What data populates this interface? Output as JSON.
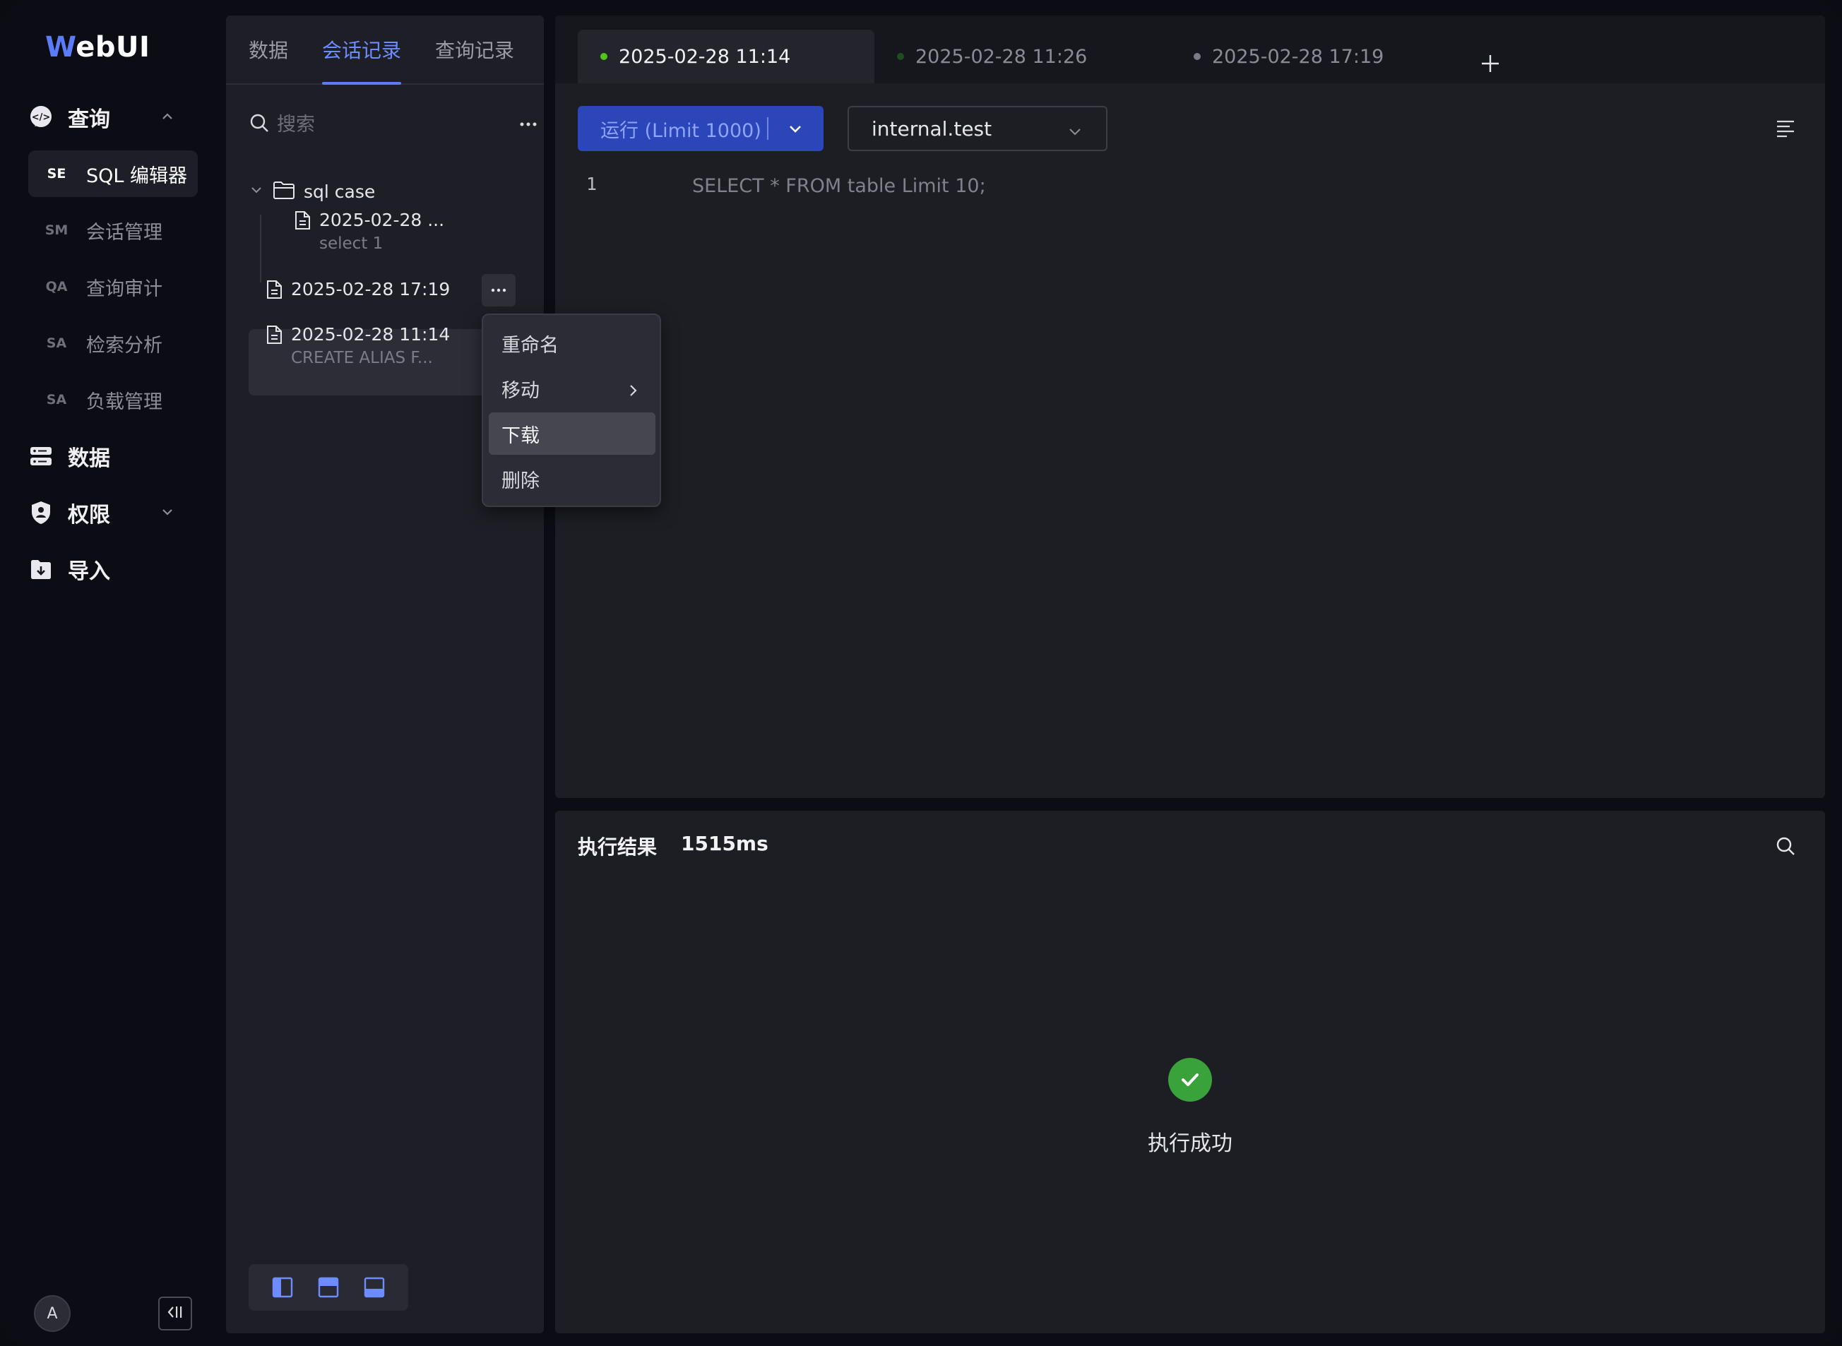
{
  "app": {
    "logo_first": "W",
    "logo_rest": "ebUI"
  },
  "nav": {
    "groups": [
      {
        "label": "查询",
        "icon": "code-chat-icon"
      },
      {
        "label": "数据",
        "icon": "database-icon"
      },
      {
        "label": "权限",
        "icon": "shield-icon"
      },
      {
        "label": "导入",
        "icon": "import-icon"
      }
    ],
    "items": [
      {
        "abbr": "SE",
        "label": "SQL 编辑器"
      },
      {
        "abbr": "SM",
        "label": "会话管理"
      },
      {
        "abbr": "QA",
        "label": "查询审计"
      },
      {
        "abbr": "SA",
        "label": "检索分析"
      },
      {
        "abbr": "SA",
        "label": "负载管理"
      }
    ],
    "avatar": "A"
  },
  "panel": {
    "tabs": [
      "数据",
      "会话记录",
      "查询记录"
    ],
    "search_placeholder": "搜索",
    "folder": "sql case",
    "files": [
      {
        "title": "2025-02-28 ...",
        "subtitle": "select 1"
      },
      {
        "title": "2025-02-28 17:19",
        "subtitle": ""
      },
      {
        "title": "2025-02-28 11:14",
        "subtitle": "CREATE ALIAS F..."
      }
    ]
  },
  "context_menu": {
    "items": [
      "重命名",
      "移动",
      "下载",
      "删除"
    ]
  },
  "editor": {
    "tabs": [
      {
        "label": "2025-02-28 11:14",
        "dot": "#52c41a"
      },
      {
        "label": "2025-02-28 11:26",
        "dot": "#1f4d1f"
      },
      {
        "label": "2025-02-28 17:19",
        "dot": "#7a7b86"
      }
    ],
    "run_label": "运行 (Limit 1000)",
    "database": "internal.test",
    "line_number": "1",
    "code": "SELECT * FROM table Limit 10;"
  },
  "results": {
    "title": "执行结果",
    "duration": "1515ms",
    "status": "执行成功"
  },
  "colors": {
    "accent": "#5b7cf7",
    "run_button": "#2b46b8",
    "success": "#3aa23a"
  }
}
